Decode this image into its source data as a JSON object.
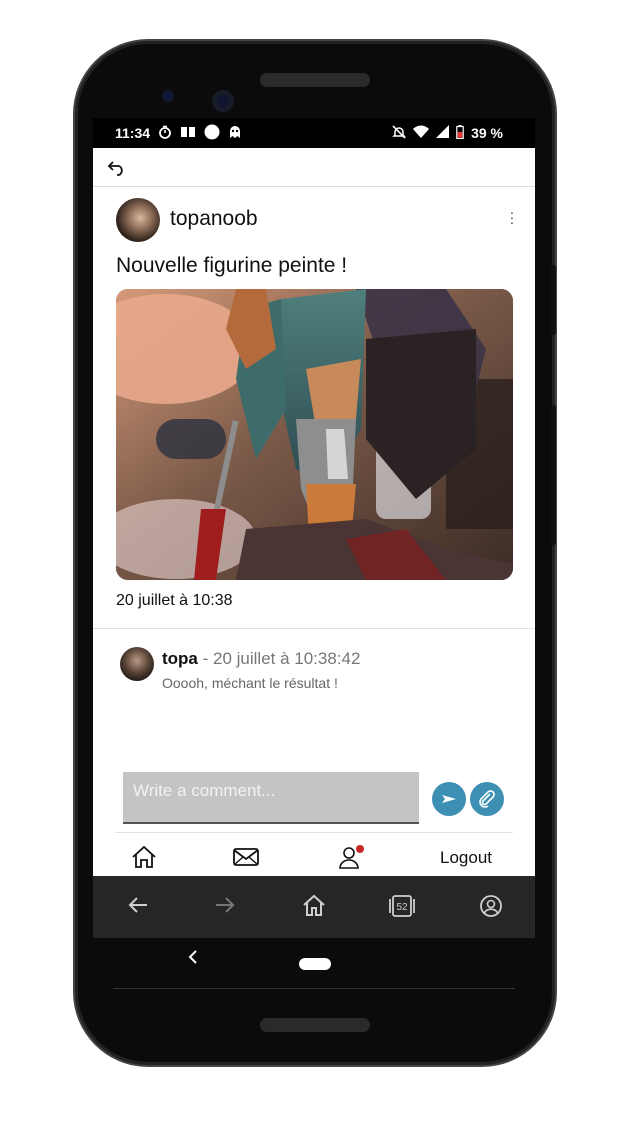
{
  "status_bar": {
    "time": "11:34",
    "battery": "39 %"
  },
  "post": {
    "author": "topanoob",
    "text": "Nouvelle figurine peinte !",
    "date": "20 juillet à 10:38"
  },
  "comments": [
    {
      "author": "topa",
      "separator": " - ",
      "timestamp": "20 juillet à 10:38:42",
      "text": "Ooooh, méchant le résultat !"
    }
  ],
  "comment_input": {
    "placeholder": "Write a comment..."
  },
  "bottom_nav": {
    "items": [
      "home-icon",
      "mail-icon",
      "user-icon",
      "logout"
    ],
    "logout_label": "Logout",
    "notification_color": "#c62828"
  },
  "browser_bar": {
    "tab_count": "52",
    "icons": [
      "back-arrow-icon",
      "forward-arrow-icon",
      "home-icon",
      "tabs-icon",
      "account-icon"
    ]
  },
  "colors": {
    "accent": "#3e8fb4",
    "input_bg": "#c4c4c4",
    "browser_bar_bg": "#262626"
  }
}
